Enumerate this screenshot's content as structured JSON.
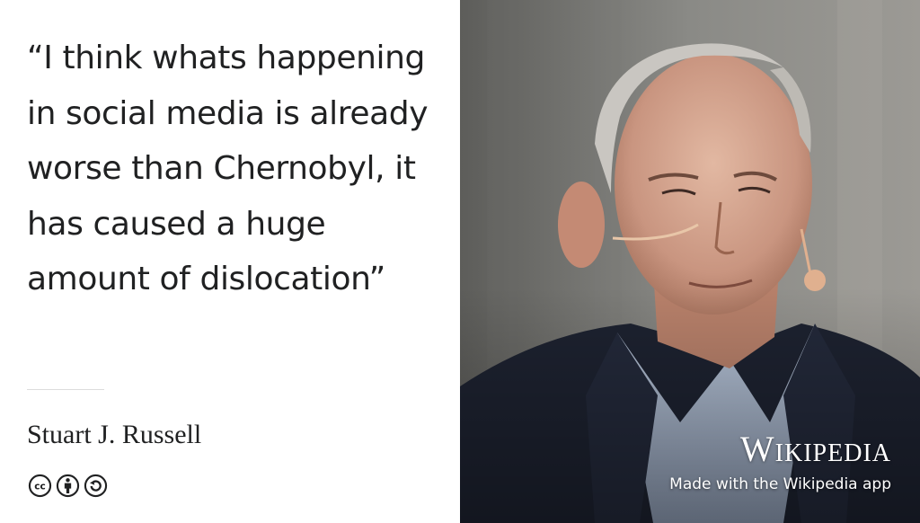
{
  "quote": {
    "text": "“I think whats happening\nin social media is already\nworse than Chernobyl, it\nhas caused a huge\namount of dislocation”"
  },
  "author": {
    "name": "Stuart J. Russell"
  },
  "license": {
    "icons": [
      "cc-icon",
      "attribution-icon",
      "share-alike-icon"
    ]
  },
  "branding": {
    "logo_text": "Wikipedia",
    "tagline": "Made with the Wikipedia app"
  },
  "colors": {
    "text": "#202122",
    "background": "#ffffff",
    "overlay_text": "#ffffff"
  }
}
